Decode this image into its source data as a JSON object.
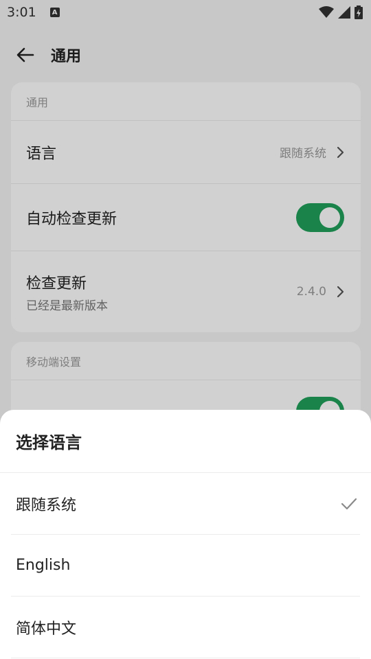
{
  "status_bar": {
    "time": "3:01",
    "notification_icon": "A"
  },
  "header": {
    "title": "通用"
  },
  "general_section": {
    "header": "通用",
    "language": {
      "label": "语言",
      "value": "跟随系统"
    },
    "auto_check_update": {
      "label": "自动检查更新",
      "enabled": true
    },
    "check_update": {
      "label": "检查更新",
      "sublabel": "已经是最新版本",
      "version": "2.4.0"
    }
  },
  "mobile_section": {
    "header": "移动端设置",
    "row_toggle_enabled": true
  },
  "language_sheet": {
    "title": "选择语言",
    "options": [
      {
        "label": "跟随系统",
        "selected": true
      },
      {
        "label": "English",
        "selected": false
      },
      {
        "label": "简体中文",
        "selected": false
      }
    ]
  },
  "colors": {
    "accent": "#1fa05b",
    "background": "#f4f4f4"
  }
}
